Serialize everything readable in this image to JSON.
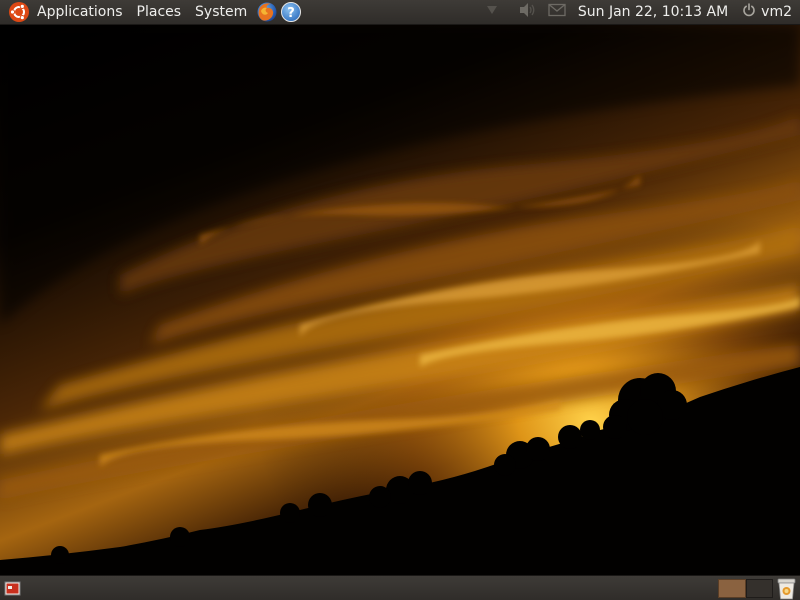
{
  "top_panel": {
    "menus": {
      "applications": "Applications",
      "places": "Places",
      "system": "System"
    },
    "launchers": [
      "firefox-icon",
      "help-icon"
    ],
    "tray": [
      "network-icon",
      "volume-icon",
      "mail-icon"
    ],
    "clock": "Sun Jan 22, 10:13 AM",
    "user": "vm2"
  },
  "bottom_panel": {
    "show_desktop": "show-desktop-icon",
    "workspaces": 2,
    "active_workspace": 1,
    "trash": "trash-icon"
  },
  "wallpaper": "sunset-clouds-silhouette",
  "colors": {
    "panel": "#3c3b37",
    "panel_text": "#eeeeec",
    "ubuntu_orange": "#dd4814",
    "workspace_active": "#8a6240"
  }
}
